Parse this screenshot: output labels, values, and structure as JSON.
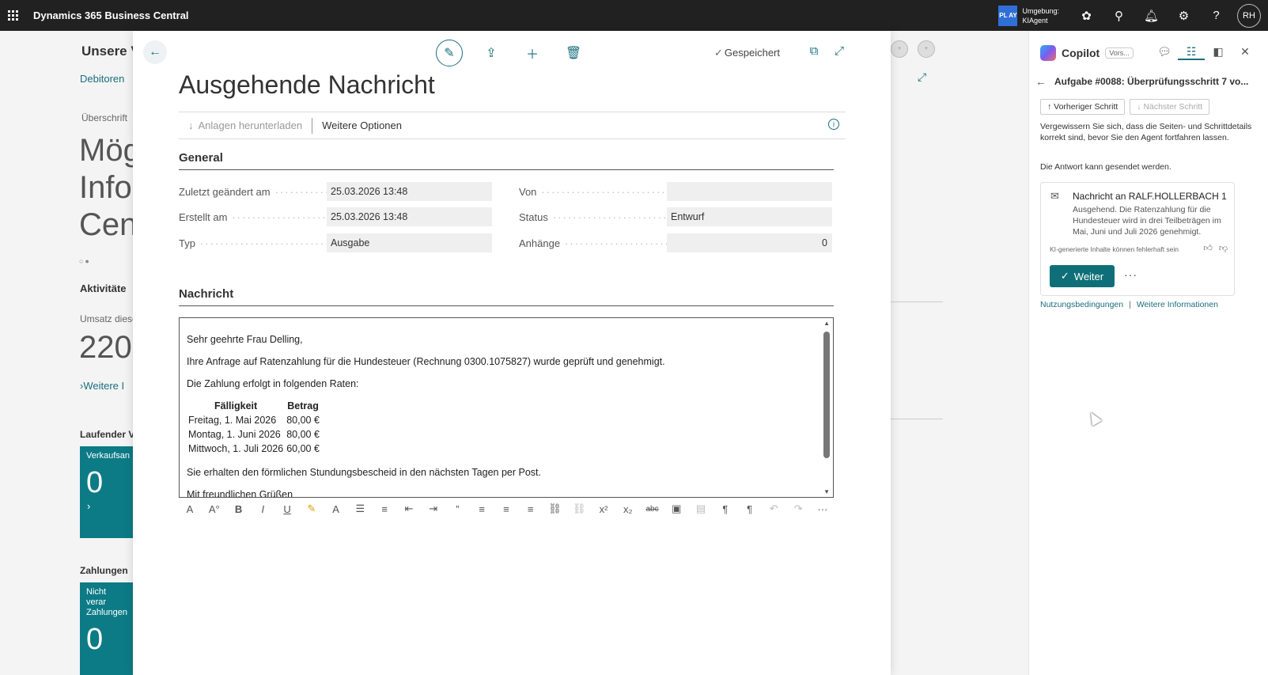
{
  "app": {
    "title": "Dynamics 365 Business Central"
  },
  "topbar": {
    "env_badge": "PL AY",
    "env_label": "Umgebung:",
    "env_name": "KIAgent",
    "user_initials": "RH"
  },
  "background": {
    "title": "Unsere V",
    "tab": "Debitoren",
    "caption": "Überschrift",
    "big_lines": [
      "Mög",
      "Info",
      "Cen"
    ],
    "section_activities": "Aktivitäte",
    "sales_label": "Umsatz diese",
    "sales_value": "220",
    "more_link": "Weitere I",
    "running_label": "Laufender Ve",
    "tile1_label": "Verkaufsan",
    "tile1_value": "0",
    "payments_label": "Zahlungen",
    "tile2_label": "Nicht verar Zahlungen",
    "tile2_value": "0"
  },
  "modal": {
    "saved_label": "Gespeichert",
    "title": "Ausgehende Nachricht",
    "cmd_download": "Anlagen herunterladen",
    "cmd_more": "Weitere Optionen",
    "general_header": "General",
    "fields": {
      "changed_label": "Zuletzt geändert am",
      "changed_value": "25.03.2026 13:48",
      "created_label": "Erstellt am",
      "created_value": "25.03.2026 13:48",
      "type_label": "Typ",
      "type_value": "Ausgabe",
      "from_label": "Von",
      "from_value": "",
      "status_label": "Status",
      "status_value": "Entwurf",
      "attachments_label": "Anhänge",
      "attachments_value": "0"
    },
    "message_header": "Nachricht",
    "message": {
      "greeting": "Sehr geehrte Frau Delling,",
      "para1": "Ihre Anfrage auf Ratenzahlung für die Hundesteuer (Rechnung 0300.1075827) wurde geprüft und genehmigt.",
      "para2": "Die Zahlung erfolgt in folgenden Raten:",
      "table_headers": [
        "Fälligkeit",
        "Betrag"
      ],
      "rows": [
        [
          "Freitag, 1. Mai 2026",
          "80,00 €"
        ],
        [
          "Montag, 1. Juni 2026",
          "80,00 €"
        ],
        [
          "Mittwoch, 1. Juli 2026",
          "60,00 €"
        ]
      ],
      "para3": "Sie erhalten den förmlichen Stundungsbescheid in den nächsten Tagen per Post.",
      "closing": "Mit freundlichen Grüßen"
    }
  },
  "copilot": {
    "title": "Copilot",
    "preview_badge": "Vors...",
    "task_title": "Aufgabe #0088: Überprüfungsschritt 7 vo...",
    "prev_step": "Vorheriger Schritt",
    "next_step": "Nächster Schritt",
    "instruction": "Vergewissern Sie sich, dass die Seiten- und Schrittdetails korrekt sind, bevor Sie den Agent fortfahren lassen.",
    "ready_text": "Die Antwort kann gesendet werden.",
    "card_title": "Nachricht an RALF.HOLLERBACH 1",
    "card_body": "Ausgehend. Die Ratenzahlung für die Hundesteuer wird in drei Teilbeträgen im Mai, Juni und Juli 2026 genehmigt.",
    "ai_note": "KI-generierte Inhalte können fehlerhaft sein",
    "continue_label": "Weiter",
    "terms_link": "Nutzungsbedingungen",
    "info_link": "Weitere Informationen"
  },
  "colors": {
    "accent": "#1a6e7f",
    "button": "#0e6f78",
    "topbar": "#212121",
    "tile": "#0c7b86"
  }
}
